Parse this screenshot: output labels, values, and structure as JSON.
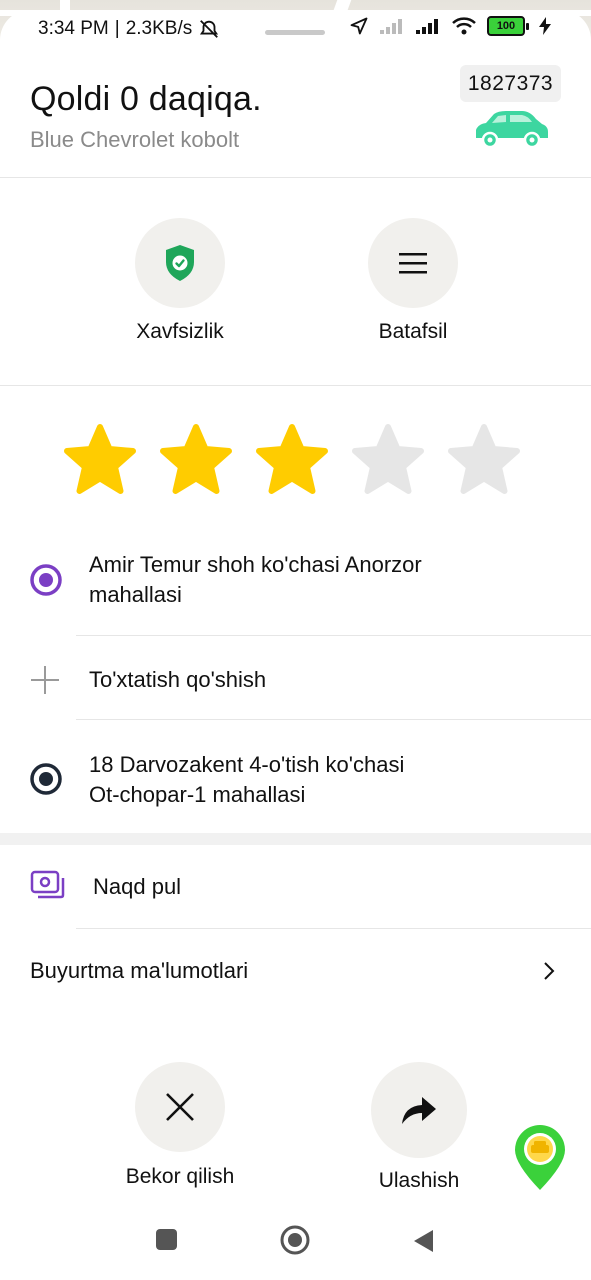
{
  "status_bar": {
    "time": "3:34 PM",
    "speed": "2.3KB/s",
    "battery": "100"
  },
  "trip": {
    "eta": "Qoldi 0 daqiqa.",
    "car": "Blue Chevrolet kobolt",
    "plate": "1827373"
  },
  "actions_top": {
    "safety_label": "Xavfsizlik",
    "details_label": "Batafsil"
  },
  "rating": {
    "value": 3,
    "max": 5,
    "filled_color": "#FFCC00",
    "empty_color": "#E6E6E6"
  },
  "route": {
    "pickup": [
      "Amir Temur shoh ko'chasi Anorzor",
      "mahallasi"
    ],
    "add_stop": "To'xtatish qo'shish",
    "destination": [
      "18 Darvozakent 4-o'tish ko'chasi",
      "Ot-chopar-1 mahallasi"
    ],
    "pickup_color": "#7B3FC4",
    "destination_color": "#1F2937"
  },
  "payment": {
    "method": "Naqd pul",
    "icon": "cash-icon"
  },
  "order_info": {
    "label": "Buyurtma ma'lumotlari"
  },
  "actions_bottom": {
    "cancel_label": "Bekor qilish",
    "share_label": "Ulashish"
  },
  "colors": {
    "accent_green": "#2ECC8F",
    "shield_green": "#1FA65A",
    "map_pin_green": "#3BD13B"
  }
}
